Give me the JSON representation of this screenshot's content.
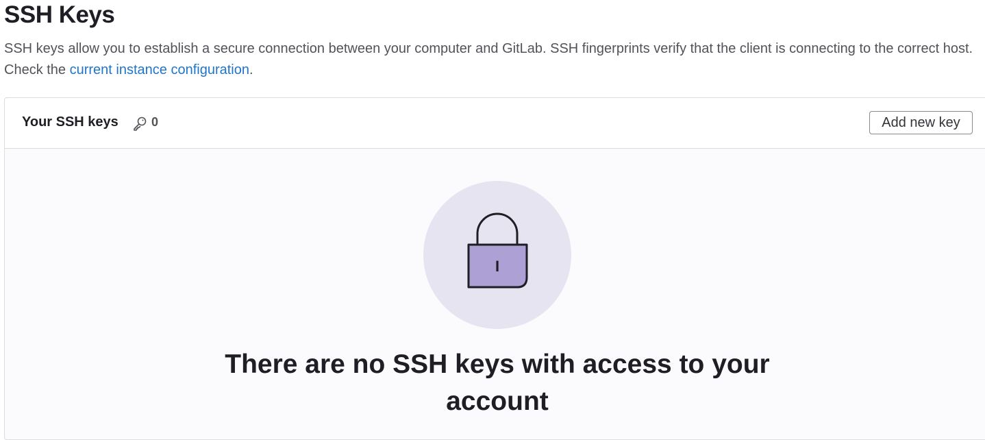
{
  "page": {
    "title": "SSH Keys",
    "description_before": "SSH keys allow you to establish a secure connection between your computer and GitLab. SSH fingerprints verify that the client is connecting to the correct host. Check the ",
    "description_link": "current instance configuration",
    "description_after": "."
  },
  "card": {
    "title": "Your SSH keys",
    "key_icon": "key-icon",
    "count": "0",
    "add_button_label": "Add new key"
  },
  "empty_state": {
    "illustration": "lock-icon",
    "lock_label": "I",
    "title": "There are no SSH keys with access to your account"
  },
  "colors": {
    "link": "#1f75cb",
    "illustration_circle": "#e7e4f2",
    "lock_body": "#aca0d5",
    "lock_stroke": "#1f1e24"
  }
}
